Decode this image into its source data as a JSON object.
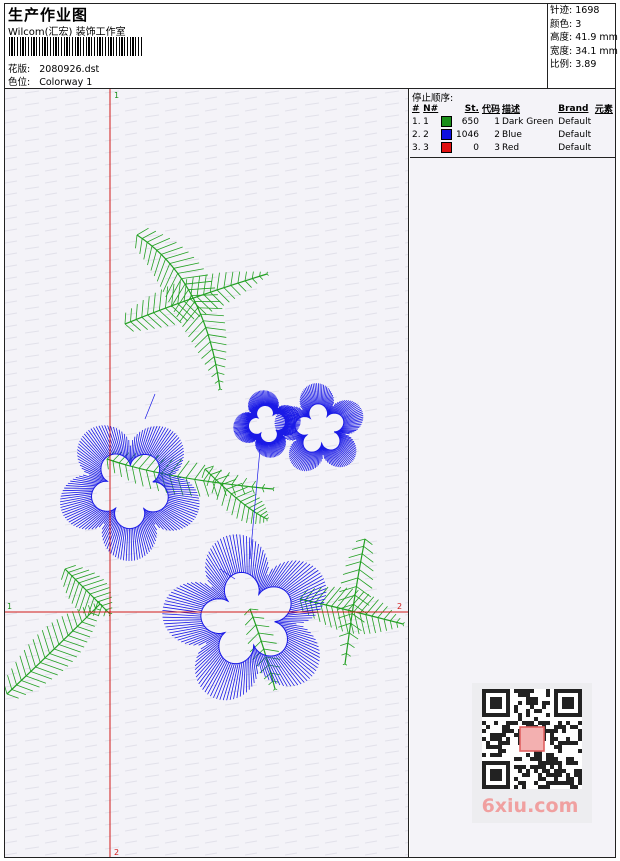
{
  "header": {
    "title": "生产作业图",
    "studio": "Wilcom(汇宏) 装饰工作室",
    "design_label": "花版:",
    "design_value": "2080926.dst",
    "colorway_label": "色位:",
    "colorway_value": "Colorway 1"
  },
  "stats": [
    {
      "label": "针迹:",
      "value": "1698"
    },
    {
      "label": "颜色:",
      "value": "3"
    },
    {
      "label": "高度:",
      "value": "41.9 mm"
    },
    {
      "label": "宽度:",
      "value": "34.1 mm"
    },
    {
      "label": "比例:",
      "value": "3.89"
    }
  ],
  "stop_sequence": {
    "title": "停止顺序:",
    "headers": {
      "num": "#",
      "n": "N#",
      "st": "St.",
      "code": "代码",
      "desc": "描述",
      "brand": "Brand",
      "elem": "元素"
    },
    "rows": [
      {
        "num": "1.",
        "n": "1",
        "color": "#1a8f1a",
        "st": "650",
        "code": "1",
        "desc": "Dark Green",
        "brand": "Default"
      },
      {
        "num": "2.",
        "n": "2",
        "color": "#1010e0",
        "st": "1046",
        "code": "2",
        "desc": "Blue",
        "brand": "Default"
      },
      {
        "num": "3.",
        "n": "3",
        "color": "#e01010",
        "st": "0",
        "code": "3",
        "desc": "Red",
        "brand": "Default"
      }
    ]
  },
  "axes": {
    "v_top": "1",
    "v_bottom": "2",
    "h_left": "1",
    "h_right": "2"
  },
  "colors": {
    "green": "#22a022",
    "blue": "#1a1ae6",
    "red": "#d01818"
  },
  "watermark": "6xiu.com"
}
